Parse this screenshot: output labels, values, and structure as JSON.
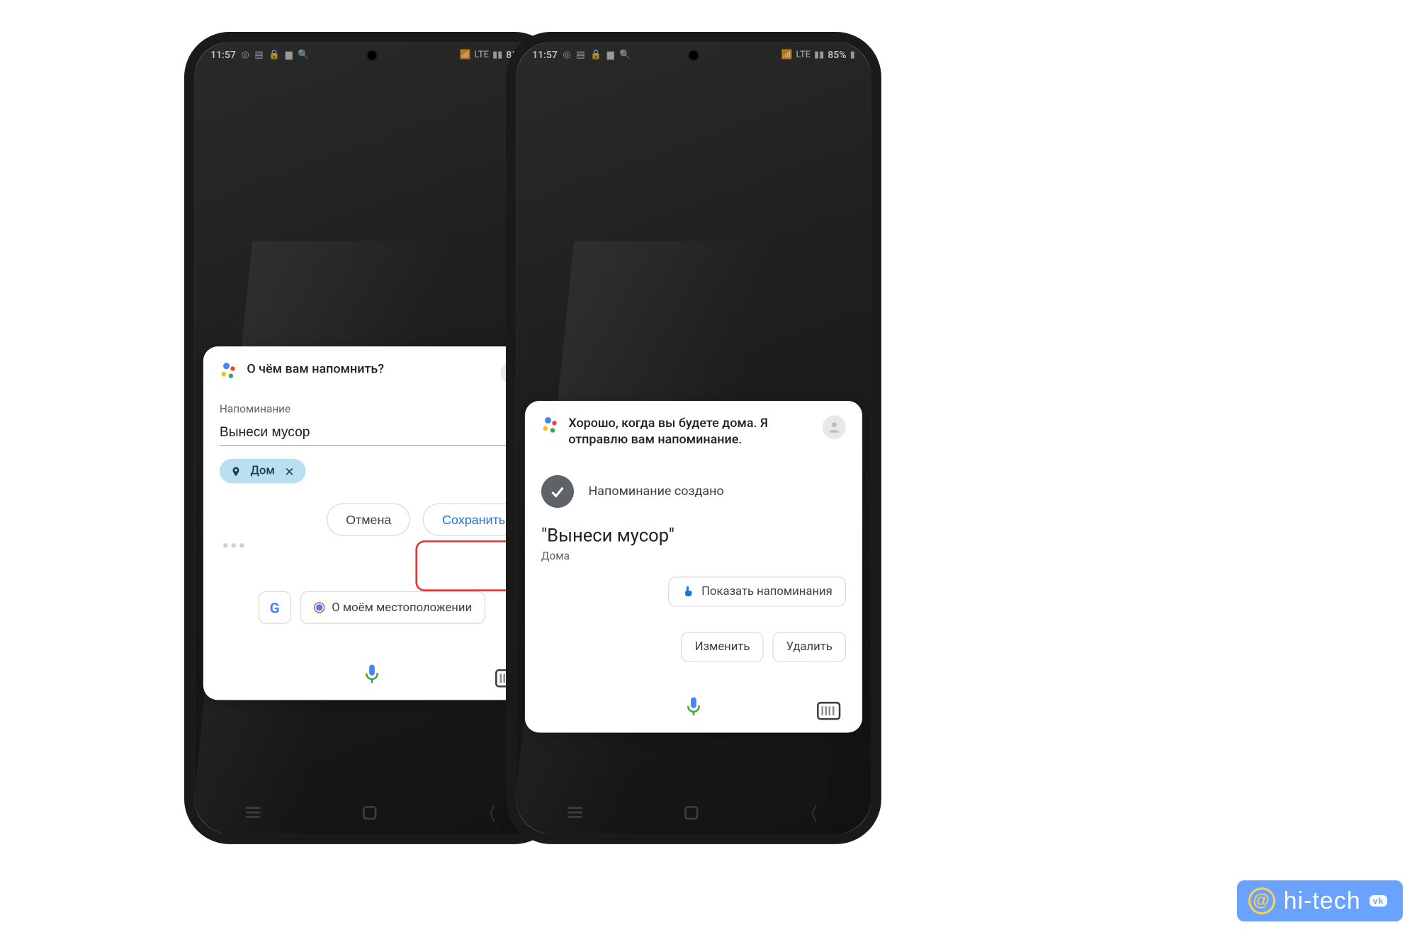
{
  "statusbar": {
    "time": "11:57",
    "battery": "85%"
  },
  "left": {
    "prompt": "О чём вам напомнить?",
    "section_label": "Напоминание",
    "reminder_text": "Вынеси мусор",
    "chip_label": "Дом",
    "cancel": "Отмена",
    "save": "Сохранить",
    "suggestion": "О моём местоположении"
  },
  "right": {
    "prompt": "Хорошо, когда вы будете дома. Я отправлю вам напоминание.",
    "created_label": "Напоминание создано",
    "reminder_quote": "\"Вынеси мусор\"",
    "location": "Дома",
    "show": "Показать напоминания",
    "edit": "Изменить",
    "delete": "Удалить"
  },
  "watermark": "hi-tech"
}
